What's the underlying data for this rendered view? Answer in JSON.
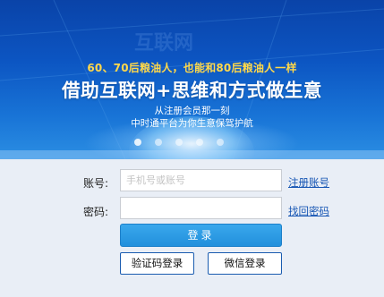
{
  "banner": {
    "tagline": "60、70后粮油人，也能和80后粮油人一样",
    "headline": "借助互联网+思维和方式做生意",
    "subline_1": "从注册会员那一刻",
    "subline_2": "中时通平台为你生意保驾护航",
    "carousel_count": 5,
    "carousel_active": 0,
    "colors": {
      "tagline": "#ffd84a",
      "background_top": "#0a43a8",
      "background_bottom": "#2b8ee3"
    }
  },
  "login": {
    "account_label": "账号:",
    "account_placeholder": "手机号或账号",
    "password_label": "密码:",
    "register_link": "注册账号",
    "forgot_link": "找回密码",
    "login_button": "登录",
    "sms_login_button": "验证码登录",
    "wechat_login_button": "微信登录",
    "colors": {
      "primary_button": "#2a9be4",
      "link": "#1756b4",
      "outline_button_border": "#1a5cb0"
    }
  }
}
